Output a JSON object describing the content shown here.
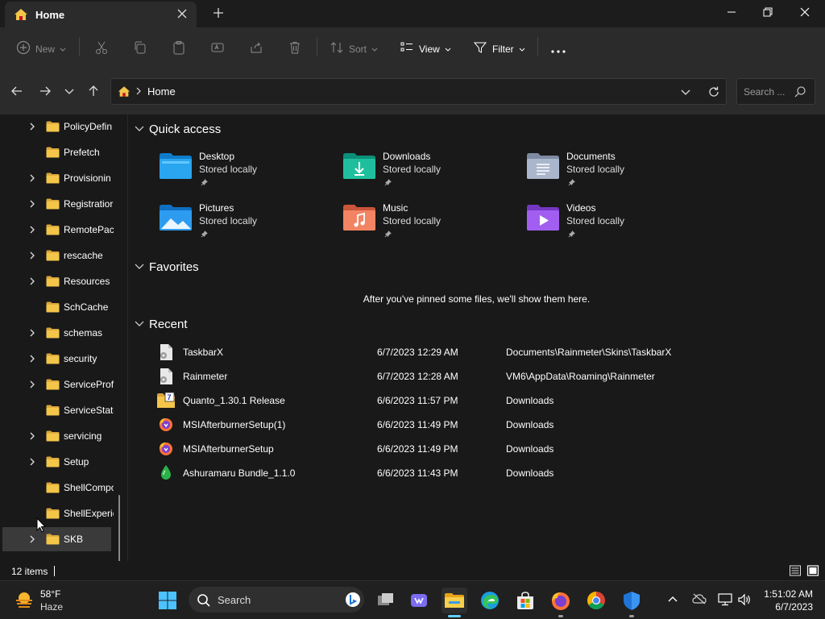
{
  "window": {
    "tab_title": "Home"
  },
  "toolbar": {
    "new_label": "New",
    "sort_label": "Sort",
    "view_label": "View",
    "filter_label": "Filter"
  },
  "address": {
    "path": "Home",
    "search_placeholder": "Search ..."
  },
  "sidebar": {
    "items": [
      {
        "label": "PolicyDefin",
        "expandable": true
      },
      {
        "label": "Prefetch",
        "expandable": false
      },
      {
        "label": "Provisionin",
        "expandable": true
      },
      {
        "label": "Registratior",
        "expandable": true
      },
      {
        "label": "RemotePac",
        "expandable": true
      },
      {
        "label": "rescache",
        "expandable": true
      },
      {
        "label": "Resources",
        "expandable": true
      },
      {
        "label": "SchCache",
        "expandable": false
      },
      {
        "label": "schemas",
        "expandable": true
      },
      {
        "label": "security",
        "expandable": true
      },
      {
        "label": "ServiceProf",
        "expandable": true
      },
      {
        "label": "ServiceState",
        "expandable": false
      },
      {
        "label": "servicing",
        "expandable": true
      },
      {
        "label": "Setup",
        "expandable": true
      },
      {
        "label": "ShellCompo",
        "expandable": false
      },
      {
        "label": "ShellExperie",
        "expandable": false
      },
      {
        "label": "SKB",
        "expandable": true,
        "selected": true
      }
    ]
  },
  "quick_access": {
    "title": "Quick access",
    "items": [
      {
        "name": "Desktop",
        "status": "Stored locally",
        "icon": "desktop-folder-icon"
      },
      {
        "name": "Downloads",
        "status": "Stored locally",
        "icon": "downloads-folder-icon"
      },
      {
        "name": "Documents",
        "status": "Stored locally",
        "icon": "documents-folder-icon"
      },
      {
        "name": "Pictures",
        "status": "Stored locally",
        "icon": "pictures-folder-icon"
      },
      {
        "name": "Music",
        "status": "Stored locally",
        "icon": "music-folder-icon"
      },
      {
        "name": "Videos",
        "status": "Stored locally",
        "icon": "videos-folder-icon"
      }
    ]
  },
  "favorites": {
    "title": "Favorites",
    "empty_message": "After you've pinned some files, we'll show them here."
  },
  "recent": {
    "title": "Recent",
    "items": [
      {
        "name": "TaskbarX",
        "date": "6/7/2023 12:29 AM",
        "location": "Documents\\Rainmeter\\Skins\\TaskbarX",
        "icon": "config-file-icon"
      },
      {
        "name": "Rainmeter",
        "date": "6/7/2023 12:28 AM",
        "location": "VM6\\AppData\\Roaming\\Rainmeter",
        "icon": "config-file-icon"
      },
      {
        "name": "Quanto_1.30.1 Release",
        "date": "6/6/2023 11:57 PM",
        "location": "Downloads",
        "icon": "archive-folder-icon"
      },
      {
        "name": "MSIAfterburnerSetup(1)",
        "date": "6/6/2023 11:49 PM",
        "location": "Downloads",
        "icon": "firefox-download-icon"
      },
      {
        "name": "MSIAfterburnerSetup",
        "date": "6/6/2023 11:49 PM",
        "location": "Downloads",
        "icon": "firefox-download-icon"
      },
      {
        "name": "Ashuramaru Bundle_1.1.0",
        "date": "6/6/2023 11:43 PM",
        "location": "Downloads",
        "icon": "droplet-file-icon"
      }
    ]
  },
  "status_bar": {
    "item_count": "12 items"
  },
  "taskbar": {
    "weather_temp": "58°F",
    "weather_desc": "Haze",
    "search_label": "Search",
    "clock_time": "1:51:02 AM",
    "clock_date": "6/7/2023"
  },
  "colors": {
    "folder_yellow": "#f3c549",
    "accent_blue": "#60cdff",
    "toolbar_bg": "#2b2b2b",
    "content_bg": "#191919"
  }
}
